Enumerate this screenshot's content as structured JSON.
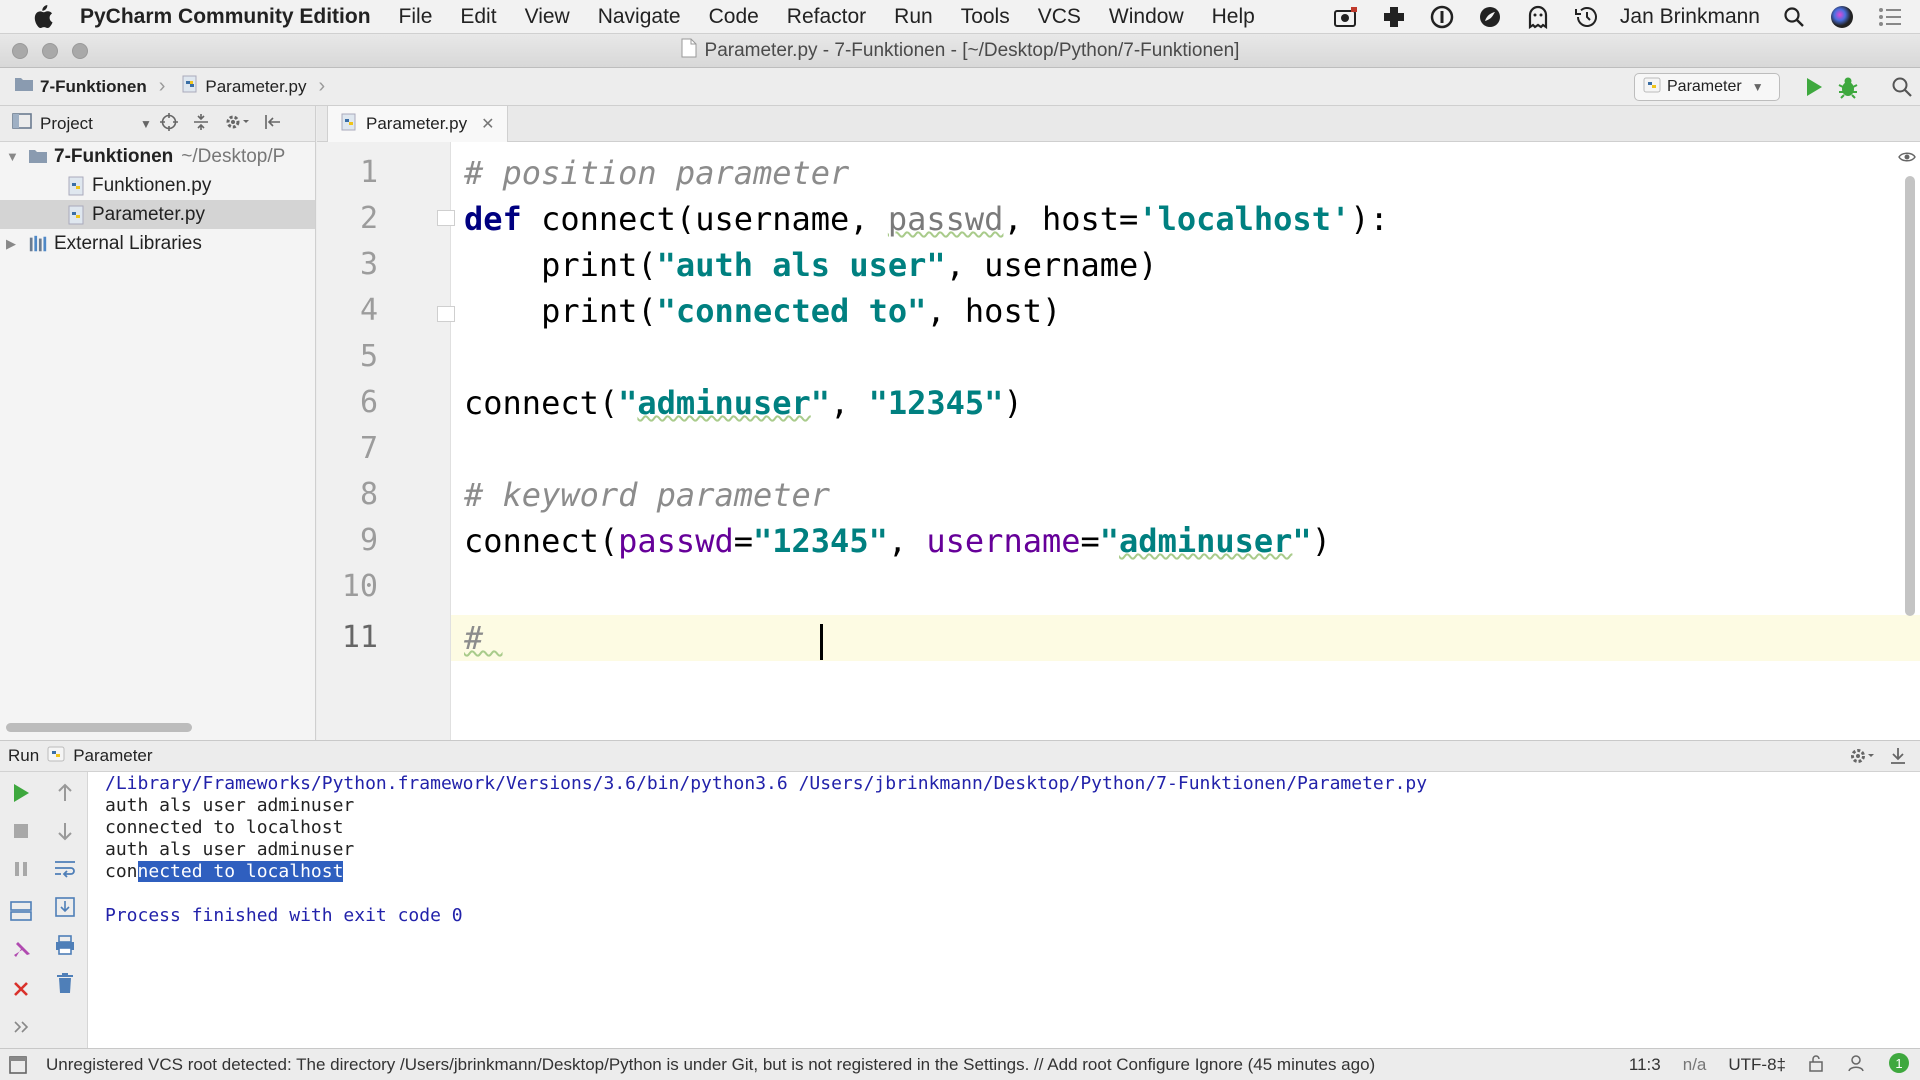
{
  "menubar": {
    "app_name": "PyCharm Community Edition",
    "items": [
      "File",
      "Edit",
      "View",
      "Navigate",
      "Code",
      "Refactor",
      "Run",
      "Tools",
      "VCS",
      "Window",
      "Help"
    ],
    "user": "Jan Brinkmann"
  },
  "window": {
    "title": "Parameter.py - 7-Funktionen - [~/Desktop/Python/7-Funktionen]"
  },
  "navbar": {
    "crumbs": [
      "7-Funktionen",
      "Parameter.py"
    ],
    "run_config": "Parameter"
  },
  "project": {
    "header": "Project",
    "root_name": "7-Funktionen",
    "root_path": "~/Desktop/P",
    "files": [
      "Funktionen.py",
      "Parameter.py"
    ],
    "external": "External Libraries"
  },
  "editor": {
    "tab": "Parameter.py",
    "line_numbers": [
      "1",
      "2",
      "3",
      "4",
      "5",
      "6",
      "7",
      "8",
      "9",
      "10",
      "11"
    ],
    "lines": {
      "l1": "# position parameter",
      "l2_kw": "def",
      "l2_a": " connect(username, ",
      "l2_b": "passwd",
      "l2_c": ", host=",
      "l2_d": "'localhost'",
      "l2_e": "):",
      "l3_a": "    print(",
      "l3_b": "\"auth als user\"",
      "l3_c": ", username)",
      "l4_a": "    print(",
      "l4_b": "\"connected to\"",
      "l4_c": ", host)",
      "l6_a": "connect(",
      "l6_b": "\"",
      "l6_c": "adminuser",
      "l6_d": "\"",
      "l6_e": ", ",
      "l6_f": "\"12345\"",
      "l6_g": ")",
      "l8": "# keyword parameter",
      "l9_a": "connect(",
      "l9_b": "passwd",
      "l9_c": "=",
      "l9_d": "\"12345\"",
      "l9_e": ", ",
      "l9_f": "username",
      "l9_g": "=",
      "l9_h": "\"",
      "l9_i": "adminuser",
      "l9_j": "\"",
      "l9_k": ")",
      "l11": "# "
    }
  },
  "run": {
    "label": "Run",
    "config": "Parameter",
    "console": {
      "cmd": "/Library/Frameworks/Python.framework/Versions/3.6/bin/python3.6 /Users/jbrinkmann/Desktop/Python/7-Funktionen/Parameter.py",
      "out1": "auth als user adminuser",
      "out2": "connected to localhost",
      "out3": "auth als user adminuser",
      "out4_a": "con",
      "out4_b": "nected to localhost",
      "exit": "Process finished with exit code 0"
    }
  },
  "status": {
    "message": "Unregistered VCS root detected: The directory /Users/jbrinkmann/Desktop/Python is under Git, but is not registered in the Settings. // Add root  Configure  Ignore (45 minutes ago)",
    "position": "11:3",
    "na": "n/a",
    "encoding": "UTF-8‡"
  },
  "colors": {
    "keyword": "#000080",
    "string": "#008080",
    "comment": "#8c8c8c",
    "kwarg": "#660099",
    "run_green": "#3ea83e",
    "selection": "#2f5fbf"
  }
}
